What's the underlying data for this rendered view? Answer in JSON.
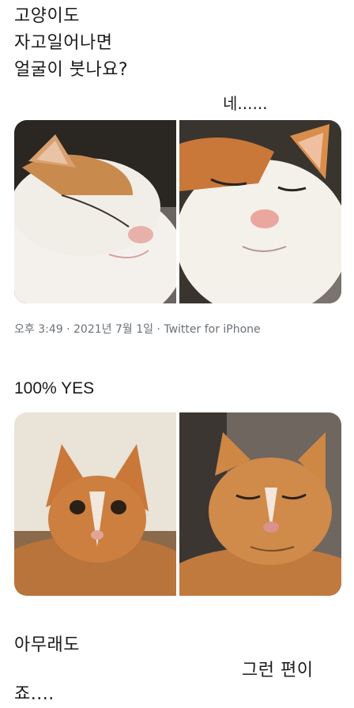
{
  "question": {
    "lines": [
      "고양이도",
      "자고일어나면",
      "얼굴이 붓나요?"
    ]
  },
  "answer_1": "네......",
  "photo_set_1": [
    {
      "icon": "sleeping-white-cat-photo"
    },
    {
      "icon": "squinting-white-cat-photo"
    }
  ],
  "tweet_meta": "오후 3:49 · 2021년 7월 1일 · Twitter for iPhone",
  "yes_text": "100% YES",
  "photo_set_2": [
    {
      "icon": "alert-orange-cat-photo"
    },
    {
      "icon": "puffy-orange-cat-photo"
    }
  ],
  "closing": {
    "line1": "아무래도",
    "line2": "그런 편이",
    "line3": "죠...."
  },
  "colors": {
    "meta_gray": "#6b7177",
    "orange_fur": "#c9783a",
    "white_fur": "#f2efea"
  }
}
